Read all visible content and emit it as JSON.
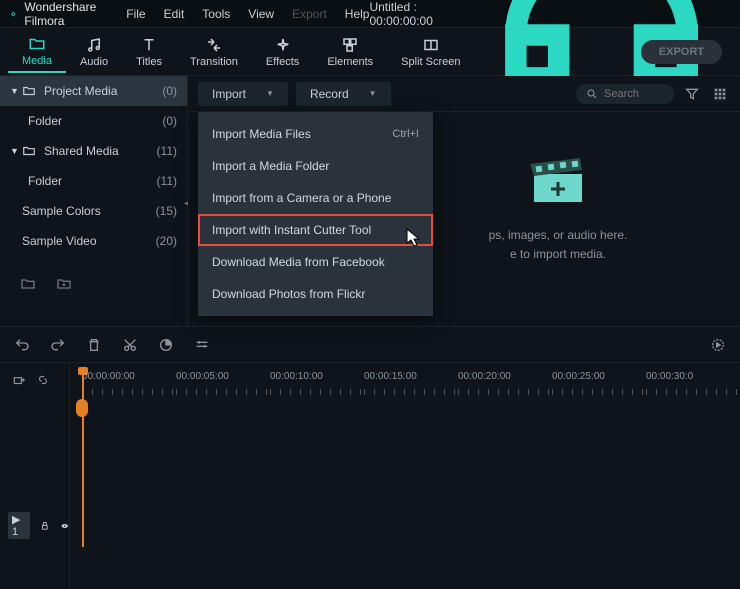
{
  "app": {
    "name": "Wondershare Filmora"
  },
  "menu": [
    "File",
    "Edit",
    "Tools",
    "View",
    "Export",
    "Help"
  ],
  "menu_disabled_index": 4,
  "doc_title": "Untitled : 00:00:00:00",
  "tabs": [
    {
      "label": "Media",
      "icon": "folder"
    },
    {
      "label": "Audio",
      "icon": "music"
    },
    {
      "label": "Titles",
      "icon": "text"
    },
    {
      "label": "Transition",
      "icon": "transition"
    },
    {
      "label": "Effects",
      "icon": "sparkle"
    },
    {
      "label": "Elements",
      "icon": "elements"
    },
    {
      "label": "Split Screen",
      "icon": "split"
    }
  ],
  "active_tab": 0,
  "export_label": "EXPORT",
  "sidebar": [
    {
      "label": "Project Media",
      "count": "(0)",
      "expandable": true,
      "expanded": true,
      "selected": true
    },
    {
      "label": "Folder",
      "count": "(0)",
      "child": true
    },
    {
      "label": "Shared Media",
      "count": "(11)",
      "expandable": true,
      "expanded": true
    },
    {
      "label": "Folder",
      "count": "(11)",
      "child": true
    },
    {
      "label": "Sample Colors",
      "count": "(15)"
    },
    {
      "label": "Sample Video",
      "count": "(20)"
    }
  ],
  "import_label": "Import",
  "record_label": "Record",
  "search": {
    "placeholder": "Search"
  },
  "dropdown": [
    {
      "label": "Import Media Files",
      "shortcut": "Ctrl+I"
    },
    {
      "label": "Import a Media Folder"
    },
    {
      "label": "Import from a Camera or a Phone"
    },
    {
      "label": "Import with Instant Cutter Tool",
      "highlighted": true
    },
    {
      "label": "Download Media from Facebook"
    },
    {
      "label": "Download Photos from Flickr"
    }
  ],
  "dropzone": {
    "line1": "ps, images, or audio here.",
    "line2": "e to import media."
  },
  "timeline": {
    "ticks": [
      "00:00:00:00",
      "00:00:05:00",
      "00:00:10:00",
      "00:00:15:00",
      "00:00:20:00",
      "00:00:25:00",
      "00:00:30:0"
    ]
  },
  "track_badge": "▶ 1"
}
